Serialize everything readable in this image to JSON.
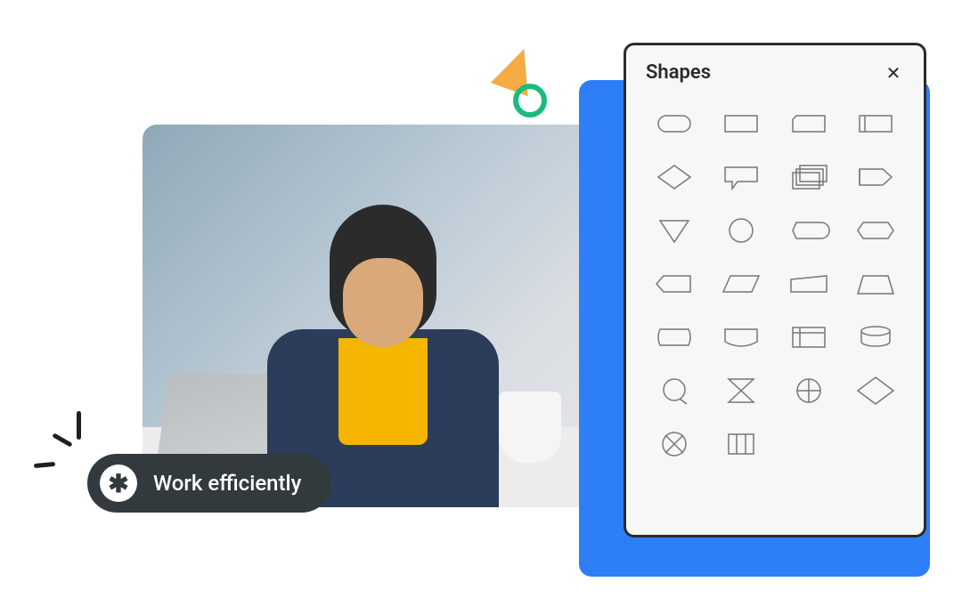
{
  "pill": {
    "icon_glyph": "✱",
    "label": "Work efficiently"
  },
  "panel": {
    "title": "Shapes",
    "close_glyph": "✕",
    "shapes": [
      "terminator",
      "process",
      "card",
      "store",
      "diamond",
      "speech",
      "stack",
      "arrow-right",
      "triangle-down",
      "circle",
      "display",
      "hexbar",
      "tag-left",
      "parallelogram",
      "manual",
      "trapezoid",
      "wave-rect",
      "curve-rect",
      "internal-storage",
      "cylinder",
      "circle-tail",
      "hourglass",
      "quartered-circle",
      "diamond-out",
      "circle-cross",
      "barrel"
    ]
  }
}
